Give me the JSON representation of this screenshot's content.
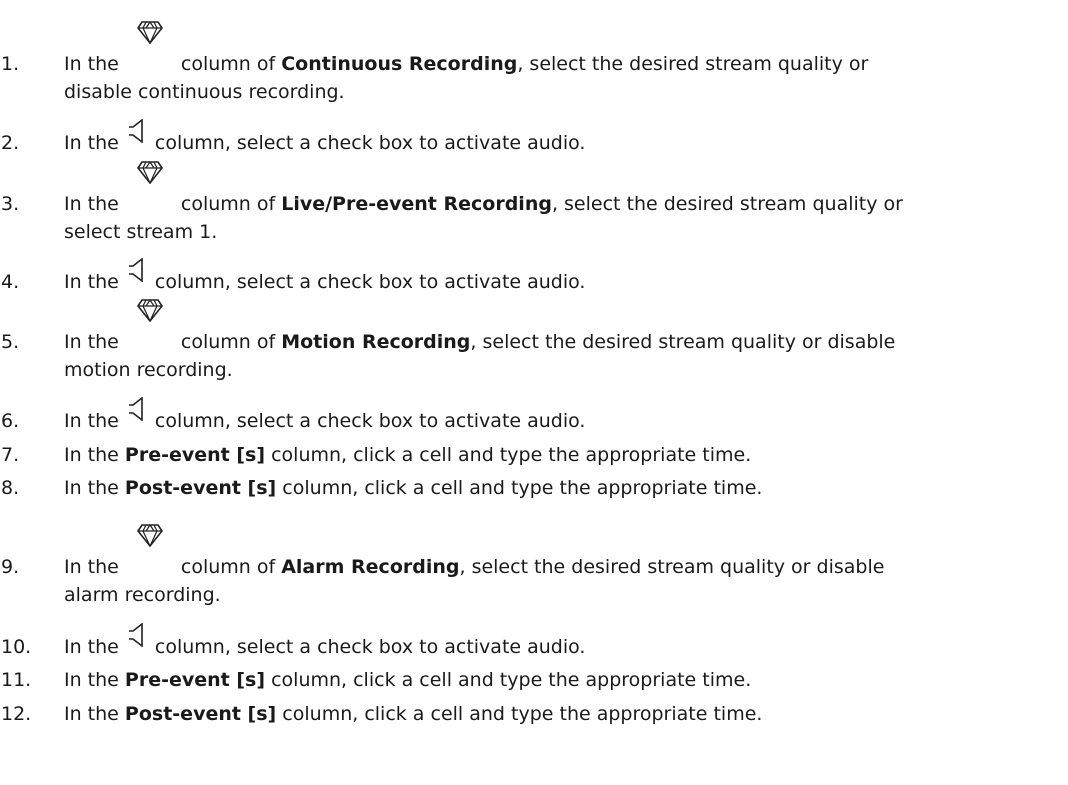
{
  "steps": [
    {
      "num": "1.",
      "a": "In the",
      "b": "column of",
      "bold": "Continuous Recording",
      "c": ", select the desired stream quality or",
      "d": "disable continuous recording.",
      "icon": "diamond-icon"
    },
    {
      "num": "2.",
      "a": "In the",
      "c": "column, select a check box to activate audio.",
      "icon": "speaker-icon"
    },
    {
      "num": "3.",
      "a": "In the",
      "b": "column of",
      "bold": "Live/Pre-event Recording",
      "c": ", select the desired stream quality or",
      "d": "select stream 1.",
      "icon": "diamond-icon"
    },
    {
      "num": "4.",
      "a": "In the",
      "c": "column, select a check box to activate audio.",
      "icon": "speaker-icon"
    },
    {
      "num": "5.",
      "a": "In the",
      "b": "column of",
      "bold": "Motion Recording",
      "c": ", select the desired stream quality or disable",
      "d": "motion recording.",
      "icon": "diamond-icon"
    },
    {
      "num": "6.",
      "a": "In the",
      "c": "column, select a check box to activate audio.",
      "icon": "speaker-icon"
    },
    {
      "num": "7.",
      "a": "In the",
      "bold": "Pre-event [s]",
      "c": "column, click a cell and type the appropriate time."
    },
    {
      "num": "8.",
      "a": "In the",
      "bold": "Post-event [s]",
      "c": "column, click a cell and type the appropriate time."
    },
    {
      "num": "9.",
      "a": "In the",
      "b": "column of",
      "bold": "Alarm Recording",
      "c": ", select the desired stream quality or disable",
      "d": "alarm recording.",
      "icon": "diamond-icon"
    },
    {
      "num": "10.",
      "a": "In the",
      "c": "column, select a check box to activate audio.",
      "icon": "speaker-icon"
    },
    {
      "num": "11.",
      "a": "In the",
      "bold": "Pre-event [s]",
      "c": "column, click a cell and type the appropriate time."
    },
    {
      "num": "12.",
      "a": "In the",
      "bold": "Post-event [s]",
      "c": "column, click a cell and type the appropriate time."
    }
  ]
}
